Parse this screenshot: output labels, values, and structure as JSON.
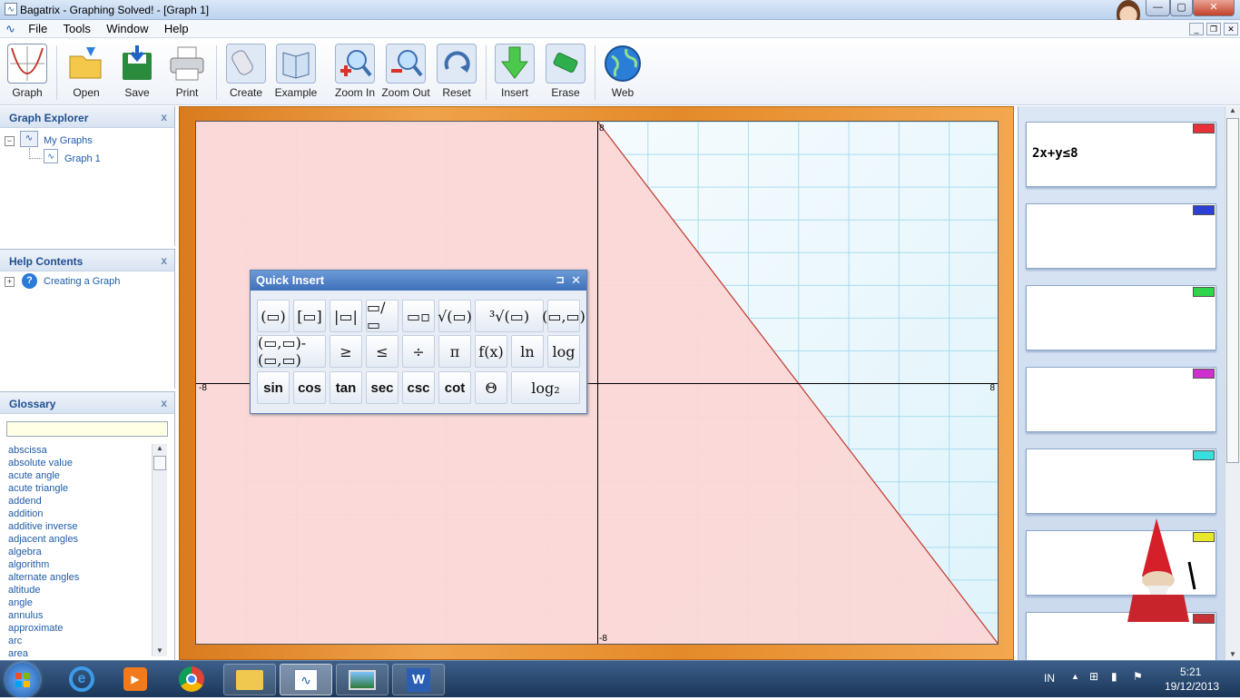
{
  "window": {
    "title": "Bagatrix - Graphing Solved! - [Graph 1]",
    "controls": [
      "—",
      "▢",
      "✕"
    ]
  },
  "menu": [
    "File",
    "Tools",
    "Window",
    "Help"
  ],
  "toolbar": [
    {
      "label": "Graph",
      "icon": "graph-icon"
    },
    {
      "label": "Open",
      "icon": "folder-open-icon"
    },
    {
      "label": "Save",
      "icon": "save-icon"
    },
    {
      "label": "Print",
      "icon": "printer-icon"
    },
    {
      "label": "Create",
      "icon": "eraser-pencil-icon"
    },
    {
      "label": "Example",
      "icon": "book-icon"
    },
    {
      "label": "Zoom In",
      "icon": "zoom-in-icon"
    },
    {
      "label": "Zoom Out",
      "icon": "zoom-out-icon"
    },
    {
      "label": "Reset",
      "icon": "reset-icon"
    },
    {
      "label": "Insert",
      "icon": "insert-arrow-icon"
    },
    {
      "label": "Erase",
      "icon": "erase-icon"
    },
    {
      "label": "Web",
      "icon": "globe-icon"
    }
  ],
  "explorer": {
    "title": "Graph Explorer",
    "close": "x",
    "root": "My Graphs",
    "child": "Graph 1"
  },
  "help": {
    "title": "Help Contents",
    "close": "x",
    "item": "Creating a Graph"
  },
  "glossary": {
    "title": "Glossary",
    "close": "x",
    "search_value": "",
    "items": [
      "abscissa",
      "absolute value",
      "acute angle",
      "acute triangle",
      "addend",
      "addition",
      "additive inverse",
      "adjacent angles",
      "algebra",
      "algorithm",
      "alternate angles",
      "altitude",
      "angle",
      "annulus",
      "approximate",
      "arc",
      "area"
    ]
  },
  "graph": {
    "xmin_label": "-8",
    "xmax_label": "8",
    "ymax_label": "8",
    "ymin_label": "-8",
    "xrange": [
      -8,
      8
    ],
    "yrange": [
      -8,
      8
    ],
    "inequality": "2x+y≤8",
    "shade_color": "#fcd6d6",
    "line_color": "#c0392b"
  },
  "equations": [
    {
      "text": "2x+y≤8",
      "color": "#e8303a"
    },
    {
      "text": "",
      "color": "#2e3fd6"
    },
    {
      "text": "",
      "color": "#2ed44a"
    },
    {
      "text": "",
      "color": "#d02fd0"
    },
    {
      "text": "",
      "color": "#36dede"
    },
    {
      "text": "",
      "color": "#e8e82a"
    },
    {
      "text": "",
      "color": "#c93038"
    }
  ],
  "quick_insert": {
    "title": "Quick Insert",
    "pin": "⊐",
    "close": "✕",
    "row1": [
      "(▭)",
      "[▭]",
      "|▭|",
      "▭/▭",
      "▭▫",
      "√(▭)",
      "³√(▭)",
      "(▭,▭)"
    ],
    "row2": [
      "(▭,▭)-(▭,▭)",
      "≥",
      "≤",
      "÷",
      "π",
      "f(x)",
      "ln",
      "log"
    ],
    "row3": [
      "sin",
      "cos",
      "tan",
      "sec",
      "csc",
      "cot",
      "Θ",
      "log₂"
    ]
  },
  "taskbar": {
    "lang": "IN",
    "time": "5:21",
    "date": "19/12/2013"
  }
}
